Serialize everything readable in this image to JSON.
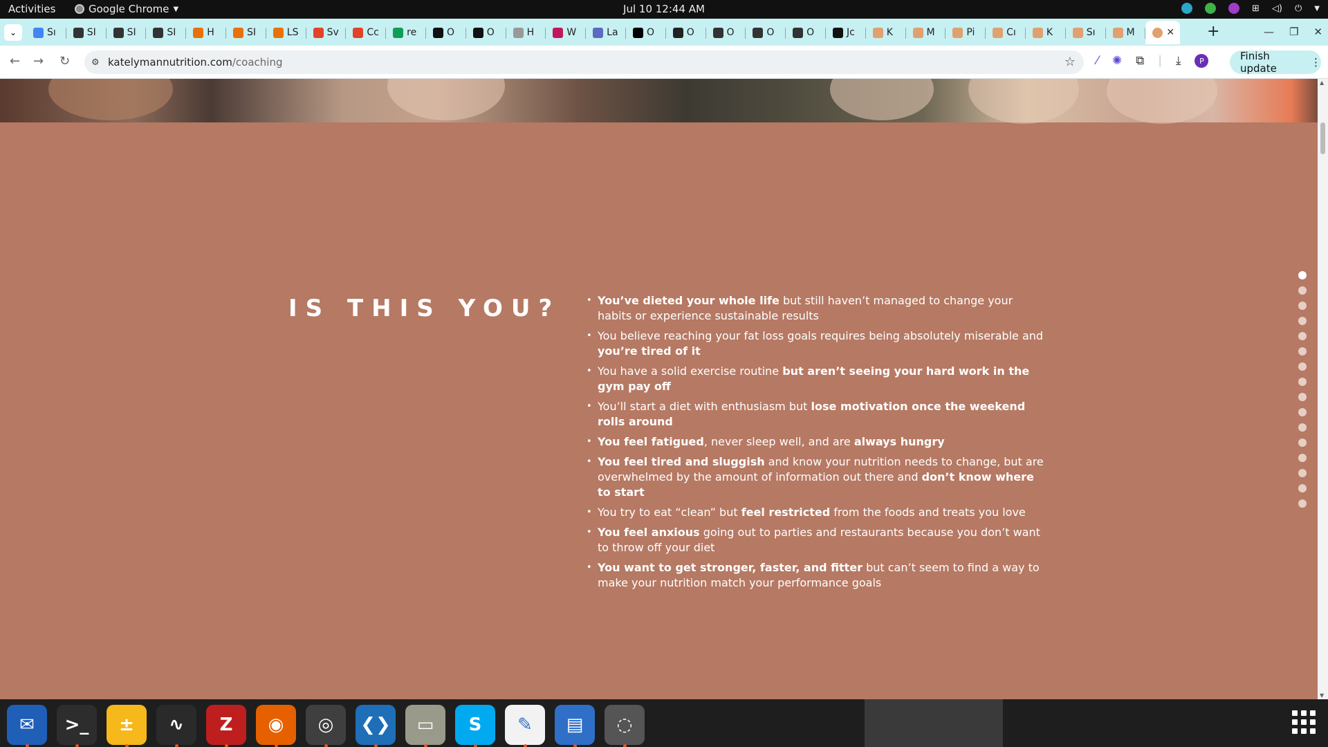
{
  "system_bar": {
    "activities": "Activities",
    "app_name": "Google Chrome",
    "clock": "Jul 10  12:44 AM"
  },
  "tabs": [
    {
      "label": "Sı",
      "color": "#4285f4"
    },
    {
      "label": "SI",
      "color": "#333333"
    },
    {
      "label": "SI",
      "color": "#333333"
    },
    {
      "label": "SI",
      "color": "#333333"
    },
    {
      "label": "H",
      "color": "#e8710a"
    },
    {
      "label": "SI",
      "color": "#e8710a"
    },
    {
      "label": "LS",
      "color": "#e8710a"
    },
    {
      "label": "Sv",
      "color": "#e24329"
    },
    {
      "label": "Cc",
      "color": "#e24329"
    },
    {
      "label": "re",
      "color": "#0f9d58"
    },
    {
      "label": "O",
      "color": "#111111"
    },
    {
      "label": "O",
      "color": "#111111"
    },
    {
      "label": "H",
      "color": "#999999"
    },
    {
      "label": "W",
      "color": "#c2185b"
    },
    {
      "label": "La",
      "color": "#5c6bc0"
    },
    {
      "label": "O",
      "color": "#000000"
    },
    {
      "label": "O",
      "color": "#222222"
    },
    {
      "label": "O",
      "color": "#333333"
    },
    {
      "label": "O",
      "color": "#333333"
    },
    {
      "label": "O",
      "color": "#333333"
    },
    {
      "label": "Jc",
      "color": "#111111"
    },
    {
      "label": "K",
      "color": "#e0a070"
    },
    {
      "label": "M",
      "color": "#e0a070"
    },
    {
      "label": "Pi",
      "color": "#e0a070"
    },
    {
      "label": "Cı",
      "color": "#e0a070"
    },
    {
      "label": "K",
      "color": "#e0a070"
    },
    {
      "label": "Sı",
      "color": "#e0a070"
    },
    {
      "label": "M",
      "color": "#e0a070"
    }
  ],
  "active_tab_close": "✕",
  "new_tab": "+",
  "toolbar": {
    "url_host": "katelymannutrition.com",
    "url_path": "/coaching",
    "avatar": "P",
    "finish_update": "Finish update"
  },
  "page": {
    "heading": "IS THIS YOU?",
    "bullets": [
      [
        {
          "b": true,
          "t": "You’ve dieted your whole life"
        },
        {
          "b": false,
          "t": " but still haven’t managed to change your habits or experience sustainable results"
        }
      ],
      [
        {
          "b": false,
          "t": "You believe reaching your fat loss goals requires being absolutely miserable and "
        },
        {
          "b": true,
          "t": "you’re tired of it"
        }
      ],
      [
        {
          "b": false,
          "t": "You have a solid exercise routine "
        },
        {
          "b": true,
          "t": "but aren’t seeing your hard work in the gym pay off"
        }
      ],
      [
        {
          "b": false,
          "t": "You’ll start a diet with enthusiasm but "
        },
        {
          "b": true,
          "t": "lose motivation once the weekend rolls around"
        }
      ],
      [
        {
          "b": true,
          "t": "You feel fatigued"
        },
        {
          "b": false,
          "t": ", never sleep well, and are "
        },
        {
          "b": true,
          "t": "always hungry"
        }
      ],
      [
        {
          "b": true,
          "t": "You feel tired and sluggish"
        },
        {
          "b": false,
          "t": " and know your nutrition needs to change, but are overwhelmed by the amount of information out there and "
        },
        {
          "b": true,
          "t": "don’t know where to start"
        }
      ],
      [
        {
          "b": false,
          "t": "You try to eat “clean” but "
        },
        {
          "b": true,
          "t": "feel restricted"
        },
        {
          "b": false,
          "t": " from the foods and treats you love"
        }
      ],
      [
        {
          "b": true,
          "t": "You feel anxious"
        },
        {
          "b": false,
          "t": " going out to parties and restaurants because you don’t want to throw off your diet"
        }
      ],
      [
        {
          "b": true,
          "t": "You want to get stronger, faster, and fitter"
        },
        {
          "b": false,
          "t": " but can’t seem to find a way to make your nutrition match your performance goals"
        }
      ]
    ],
    "section_dots": 16,
    "active_dot": 0
  },
  "dock": [
    {
      "name": "thunderbird-icon",
      "glyph": "✉",
      "bg": "#1f5fb8"
    },
    {
      "name": "terminal-icon",
      "glyph": ">_",
      "bg": "#2d2d2d"
    },
    {
      "name": "calculator-icon",
      "glyph": "±",
      "bg": "#f6b81a"
    },
    {
      "name": "system-monitor-icon",
      "glyph": "∿",
      "bg": "#2a2a2a"
    },
    {
      "name": "filezilla-icon",
      "glyph": "Z",
      "bg": "#bf1e1e"
    },
    {
      "name": "firefox-icon",
      "glyph": "◉",
      "bg": "#e66000"
    },
    {
      "name": "chrome-icon",
      "glyph": "◎",
      "bg": "#3f3f3f"
    },
    {
      "name": "vscode-icon",
      "glyph": "❮❯",
      "bg": "#1e6fb8"
    },
    {
      "name": "files-icon",
      "glyph": "▭",
      "bg": "#9a9a8a"
    },
    {
      "name": "skype-icon",
      "glyph": "S",
      "bg": "#00a9f0"
    },
    {
      "name": "text-editor-icon",
      "glyph": "✎",
      "bg": "#f2f2f2"
    },
    {
      "name": "document-viewer-icon",
      "glyph": "▤",
      "bg": "#2f6fc8"
    },
    {
      "name": "disc-icon",
      "glyph": "◌",
      "bg": "#555555"
    }
  ]
}
